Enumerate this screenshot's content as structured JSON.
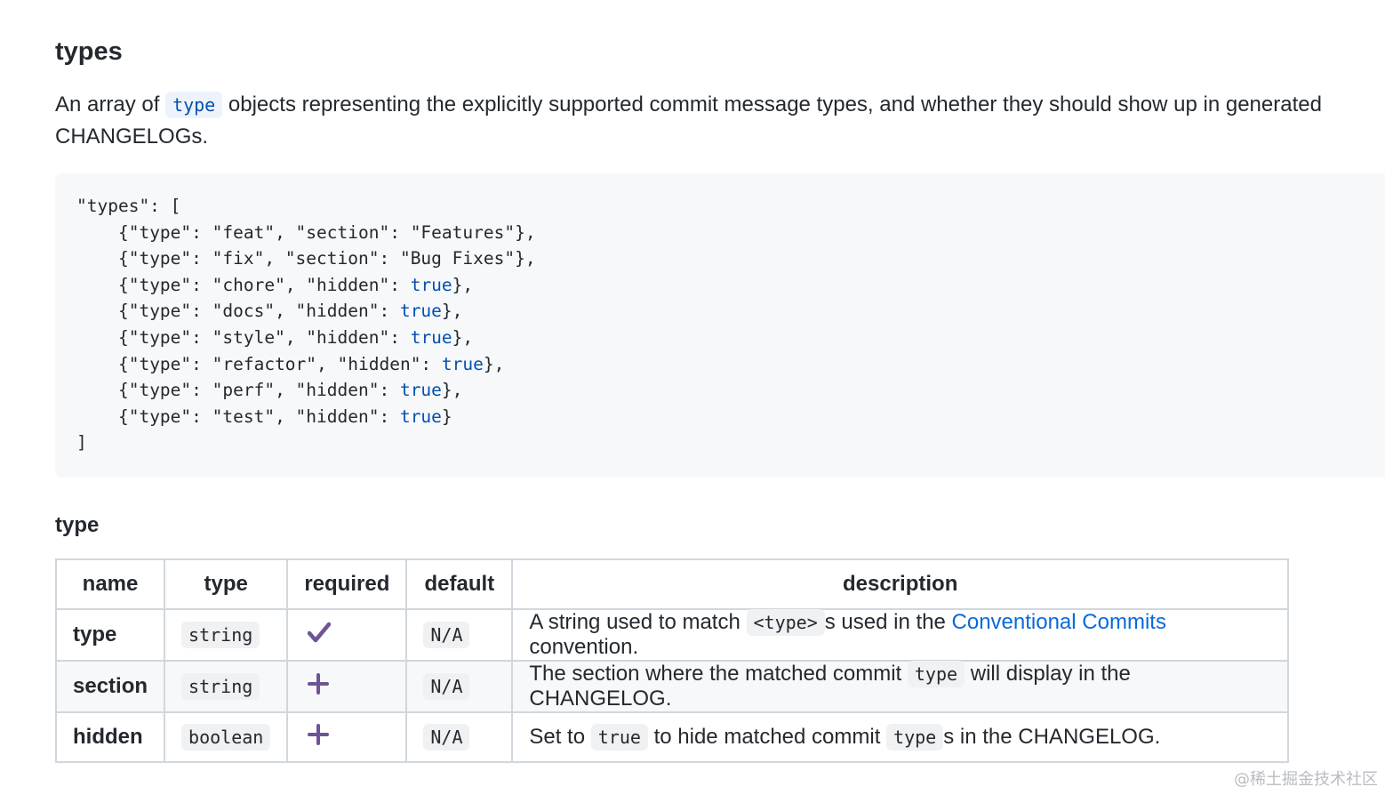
{
  "heading": "types",
  "intro": {
    "before": "An array of",
    "code": "type",
    "after": "objects representing the explicitly supported commit message types, and whether they should show up in generated CHANGELOGs."
  },
  "code_block": {
    "open": "\"types\": [",
    "lines": [
      {
        "prefix": "{\"type\": \"feat\", \"section\": \"Features\"},",
        "keyword": "",
        "suffix": ""
      },
      {
        "prefix": "{\"type\": \"fix\", \"section\": \"Bug Fixes\"},",
        "keyword": "",
        "suffix": ""
      },
      {
        "prefix": "{\"type\": \"chore\", \"hidden\": ",
        "keyword": "true",
        "suffix": "},"
      },
      {
        "prefix": "{\"type\": \"docs\", \"hidden\": ",
        "keyword": "true",
        "suffix": "},"
      },
      {
        "prefix": "{\"type\": \"style\", \"hidden\": ",
        "keyword": "true",
        "suffix": "},"
      },
      {
        "prefix": "{\"type\": \"refactor\", \"hidden\": ",
        "keyword": "true",
        "suffix": "},"
      },
      {
        "prefix": "{\"type\": \"perf\", \"hidden\": ",
        "keyword": "true",
        "suffix": "},"
      },
      {
        "prefix": "{\"type\": \"test\", \"hidden\": ",
        "keyword": "true",
        "suffix": "}"
      }
    ],
    "close": "]"
  },
  "subheading": "type",
  "table": {
    "headers": [
      "name",
      "type",
      "required",
      "default",
      "description"
    ],
    "rows": [
      {
        "name": "type",
        "type": "string",
        "required_icon": "check-icon",
        "default": "N/A",
        "desc": {
          "t1": "A string used to match",
          "c1": "<type>",
          "t2": "s used in the",
          "link": "Conventional Commits",
          "t3": "convention."
        }
      },
      {
        "name": "section",
        "type": "string",
        "required_icon": "plus-icon",
        "default": "N/A",
        "desc": {
          "t1": "The section where the matched commit",
          "c1": "type",
          "t2": "will display in the CHANGELOG."
        }
      },
      {
        "name": "hidden",
        "type": "boolean",
        "required_icon": "plus-icon",
        "default": "N/A",
        "desc": {
          "t1": "Set to",
          "c1": "true",
          "t2": "to hide matched commit",
          "c2": "type",
          "t3": "s in the CHANGELOG."
        }
      }
    ]
  },
  "watermark": "@稀土掘金技术社区",
  "colors": {
    "text": "#24292f",
    "link": "#0969da",
    "keyword": "#0550ae",
    "icon": "#6e5494",
    "code_bg": "#f6f8fa",
    "border": "#d0d7de"
  }
}
